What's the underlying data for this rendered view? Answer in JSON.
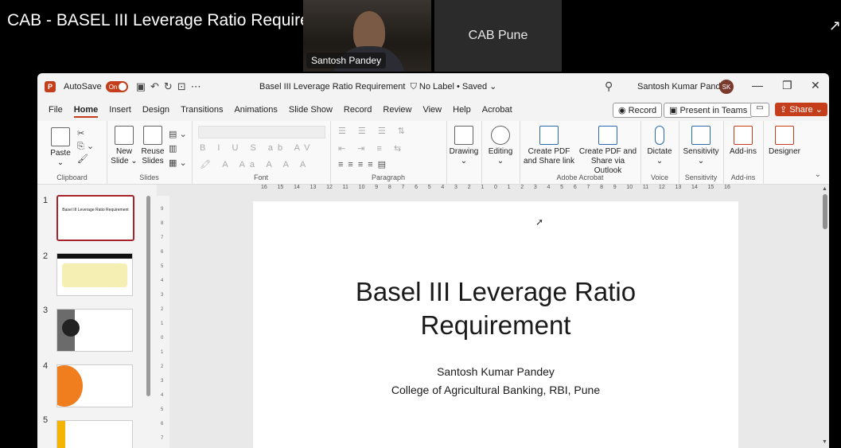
{
  "meeting": {
    "title": "CAB - BASEL III Leverage Ratio Requirements",
    "presenter_name": "Santosh Pandey",
    "other_participant": "CAB Pune"
  },
  "app": {
    "autosave_label": "AutoSave",
    "autosave_state": "On",
    "document_title": "Basel III Leverage Ratio Requirement",
    "label_status": "No Label • Saved",
    "user_name": "Santosh Kumar Pandey",
    "user_initials": "SK",
    "accent_color": "#c43e1c"
  },
  "menu": {
    "items": [
      "File",
      "Home",
      "Insert",
      "Design",
      "Transitions",
      "Animations",
      "Slide Show",
      "Record",
      "Review",
      "View",
      "Help",
      "Acrobat"
    ],
    "active": "Home",
    "record_button": "Record",
    "present_button": "Present in Teams",
    "share_button": "Share"
  },
  "ribbon": {
    "paste": "Paste",
    "clipboard": "Clipboard",
    "new_slide": "New Slide",
    "reuse_slides": "Reuse Slides",
    "slides": "Slides",
    "font": "Font",
    "paragraph": "Paragraph",
    "drawing": "Drawing",
    "editing": "Editing",
    "create_pdf_share": "Create PDF and Share link",
    "create_pdf_outlook": "Create PDF and Share via Outlook",
    "adobe_acrobat": "Adobe Acrobat",
    "dictate": "Dictate",
    "voice": "Voice",
    "sensitivity": "Sensitivity",
    "sensitivity_group": "Sensitivity",
    "addins": "Add-ins",
    "addins_group": "Add-ins",
    "designer": "Designer"
  },
  "thumbnails": [
    {
      "num": "1",
      "title": "Basel III Leverage Ratio Requirement"
    },
    {
      "num": "2"
    },
    {
      "num": "3"
    },
    {
      "num": "4"
    },
    {
      "num": "5"
    }
  ],
  "ruler": {
    "horizontal": [
      "16",
      "15",
      "14",
      "13",
      "12",
      "11",
      "10",
      "9",
      "8",
      "7",
      "6",
      "5",
      "4",
      "3",
      "2",
      "1",
      "0",
      "1",
      "2",
      "3",
      "4",
      "5",
      "6",
      "7",
      "8",
      "9",
      "10",
      "11",
      "12",
      "13",
      "14",
      "15",
      "16"
    ],
    "vertical": [
      "9",
      "8",
      "7",
      "6",
      "5",
      "4",
      "3",
      "2",
      "1",
      "0",
      "1",
      "2",
      "3",
      "4",
      "5",
      "6",
      "7"
    ]
  },
  "slide": {
    "title_line1": "Basel III Leverage Ratio",
    "title_line2": "Requirement",
    "author": "Santosh Kumar Pandey",
    "organization": "College of Agricultural Banking, RBI, Pune"
  }
}
